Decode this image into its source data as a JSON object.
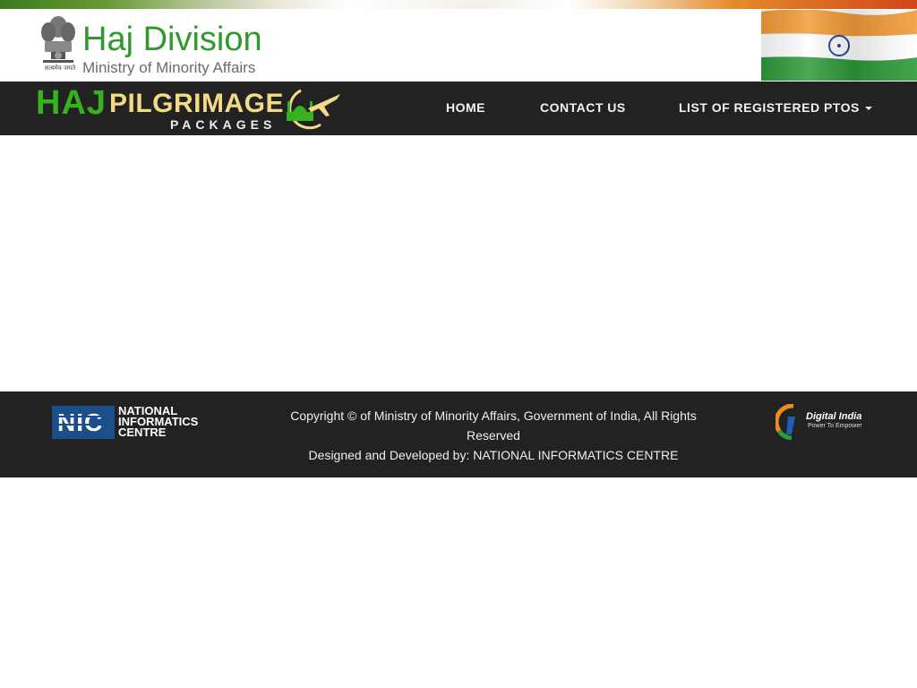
{
  "header": {
    "title": "Haj Division",
    "subtitle": "Ministry of Minority Affairs",
    "emblem_caption": "सत्यमेव जयते"
  },
  "brand": {
    "haj": "HAJ",
    "pilgrimage": "PILGRIMAGE",
    "packages": "PACKAGES"
  },
  "nav": {
    "items": [
      {
        "label": "HOME"
      },
      {
        "label": "CONTACT US"
      },
      {
        "label": "LIST OF REGISTERED PTOS",
        "dropdown": true
      }
    ]
  },
  "footer": {
    "nic": {
      "letters": "NIC",
      "line1": "NATIONAL",
      "line2": "INFORMATICS",
      "line3": "CENTRE"
    },
    "copyright": "Copyright © of Ministry of Minority Affairs, Government of India, All Rights Reserved",
    "designed_by": "Designed and Developed by: NATIONAL INFORMATICS CENTRE",
    "digital_india": {
      "title": "Digital India",
      "tagline": "Power To Empower"
    }
  },
  "colors": {
    "navbar_bg": "#222222",
    "title_green": "#2e9a2a",
    "brand_gold": "#f2da86",
    "brand_green": "#35b21d"
  }
}
